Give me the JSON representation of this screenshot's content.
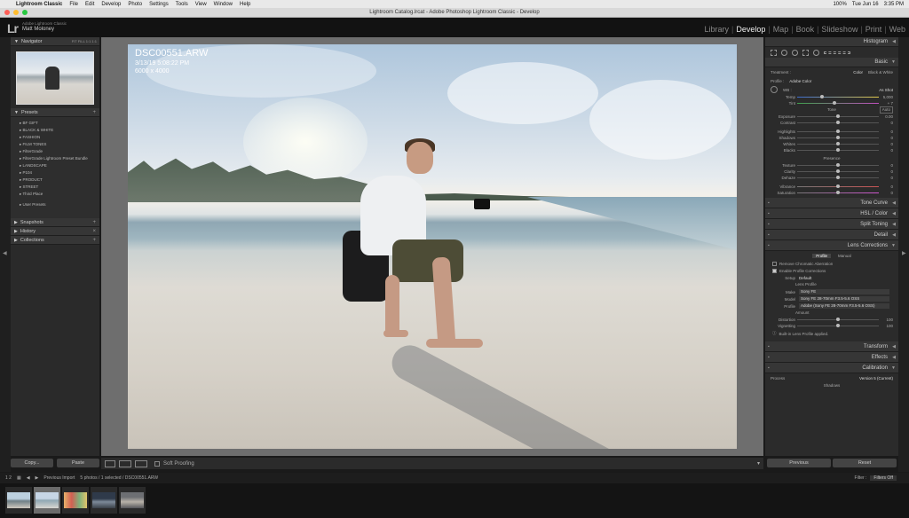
{
  "menubar": {
    "app": "Lightroom Classic",
    "items": [
      "File",
      "Edit",
      "Develop",
      "Photo",
      "Settings",
      "Tools",
      "View",
      "Window",
      "Help"
    ],
    "right": [
      "100%",
      "Tue Jun 16",
      "3:35 PM"
    ]
  },
  "window": {
    "title": "Lightroom Catalog.lrcat - Adobe Photoshop Lightroom Classic - Develop"
  },
  "identity": {
    "logo": "Lr",
    "subtitle": "Adobe Lightroom Classic",
    "user": "Matt Moloney"
  },
  "modules": {
    "items": [
      "Library",
      "Develop",
      "Map",
      "Book",
      "Slideshow",
      "Print",
      "Web"
    ],
    "active": "Develop"
  },
  "left": {
    "navigator": "Navigator",
    "nav_options": "FIT   FILL   1:1   1:1",
    "presets_title": "Presets",
    "presets": [
      "BF GIFT",
      "BLACK & WHITE",
      "FASHION",
      "FILM TONES",
      "FilterGrade",
      "FilterGrade Lightroom Preset Bundle",
      "LANDSCAPE",
      "P104",
      "PRODUCT",
      "STREET",
      "Third Place"
    ],
    "user_presets": "User Presets",
    "snapshots": "Snapshots",
    "history": "History",
    "collections": "Collections",
    "copy": "Copy...",
    "paste": "Paste"
  },
  "image": {
    "name": "DSC00551.ARW",
    "date": "3/13/19 5:08:22 PM",
    "dims": "6000 x 4000"
  },
  "toolbar": {
    "soft_proofing": "Soft Proofing"
  },
  "right": {
    "histogram": "Histogram",
    "basic": "Basic",
    "treatment_label": "Treatment :",
    "treatment_color": "Color",
    "treatment_bw": "Black & White",
    "profile_label": "Profile :",
    "profile_value": "Adobe Color",
    "wb_label": "WB :",
    "wb_value": "As Shot",
    "temp_label": "Temp",
    "temp_value": "5,000",
    "tint_label": "Tint",
    "tint_value": "+ 7",
    "tone": "Tone",
    "auto": "Auto",
    "tone_rows": [
      {
        "label": "Exposure",
        "value": "0.00"
      },
      {
        "label": "Contrast",
        "value": "0"
      },
      {
        "label": "Highlights",
        "value": "0"
      },
      {
        "label": "Shadows",
        "value": "0"
      },
      {
        "label": "Whites",
        "value": "0"
      },
      {
        "label": "Blacks",
        "value": "0"
      }
    ],
    "presence": "Presence",
    "presence_rows": [
      {
        "label": "Texture",
        "value": "0"
      },
      {
        "label": "Clarity",
        "value": "0"
      },
      {
        "label": "Dehaze",
        "value": "0"
      },
      {
        "label": "Vibrance",
        "value": "0"
      },
      {
        "label": "Saturation",
        "value": "0"
      }
    ],
    "tone_curve": "Tone Curve",
    "hsl": "HSL / Color",
    "split_toning": "Split Toning",
    "detail": "Detail",
    "lens_corrections": "Lens Corrections",
    "lens_tab_profile": "Profile",
    "lens_tab_manual": "Manual",
    "remove_ca": "Remove Chromatic Aberration",
    "enable_profile": "Enable Profile Corrections",
    "setup_label": "Setup",
    "setup_value": "Default",
    "lens_profile": "Lens Profile",
    "make_label": "Make",
    "make_value": "Sony FE",
    "model_label": "Model",
    "model_value": "Sony FE 28-70mm F3.5-5.6 OSS",
    "profile2_label": "Profile",
    "profile2_value": "Adobe (Sony FE 28-70mm F3.5-5.6 OSS)",
    "amount": "Amount",
    "distortion_label": "Distortion",
    "distortion_value": "100",
    "vignetting_label": "Vignetting",
    "vignetting_value": "100",
    "builtin_note": "Built-in Lens Profile applied.",
    "transform": "Transform",
    "effects": "Effects",
    "calibration": "Calibration",
    "process_label": "Process",
    "process_value": "Version 5 (Current)",
    "shadows": "Shadows",
    "previous": "Previous",
    "reset": "Reset"
  },
  "filmstrip": {
    "pages": "1   2",
    "source": "Previous Import",
    "count": "5 photos / 1 selected / DSC00551.ARW",
    "filter_label": "Filter :",
    "filter_value": "Filters Off"
  },
  "colors": {
    "accent": "#cfcfcf",
    "panel": "#2b2b2b",
    "center": "#6e6e6e"
  }
}
